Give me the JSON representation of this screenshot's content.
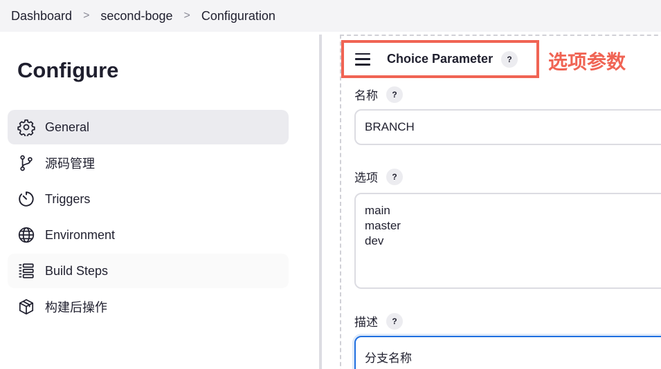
{
  "breadcrumb": {
    "items": [
      "Dashboard",
      "second-boge",
      "Configuration"
    ],
    "separator": ">"
  },
  "sidebar": {
    "title": "Configure",
    "items": [
      {
        "label": "General",
        "icon": "gear-icon",
        "active": true
      },
      {
        "label": "源码管理",
        "icon": "git-branch-icon",
        "active": false
      },
      {
        "label": "Triggers",
        "icon": "timer-icon",
        "active": false
      },
      {
        "label": "Environment",
        "icon": "globe-icon",
        "active": false
      },
      {
        "label": "Build Steps",
        "icon": "list-steps-icon",
        "active": false
      },
      {
        "label": "构建后操作",
        "icon": "package-icon",
        "active": false
      }
    ]
  },
  "parameter": {
    "title": "Choice Parameter",
    "help": "?",
    "annotation": "选项参数",
    "name_label": "名称",
    "name_value": "BRANCH",
    "choices_label": "选项",
    "choices": [
      "main",
      "master",
      "dev"
    ],
    "description_label": "描述",
    "description_value": "分支名称"
  },
  "colors": {
    "accent_highlight": "#f06454",
    "focus": "#1f6fe0",
    "active_item_bg": "#ebebef"
  }
}
